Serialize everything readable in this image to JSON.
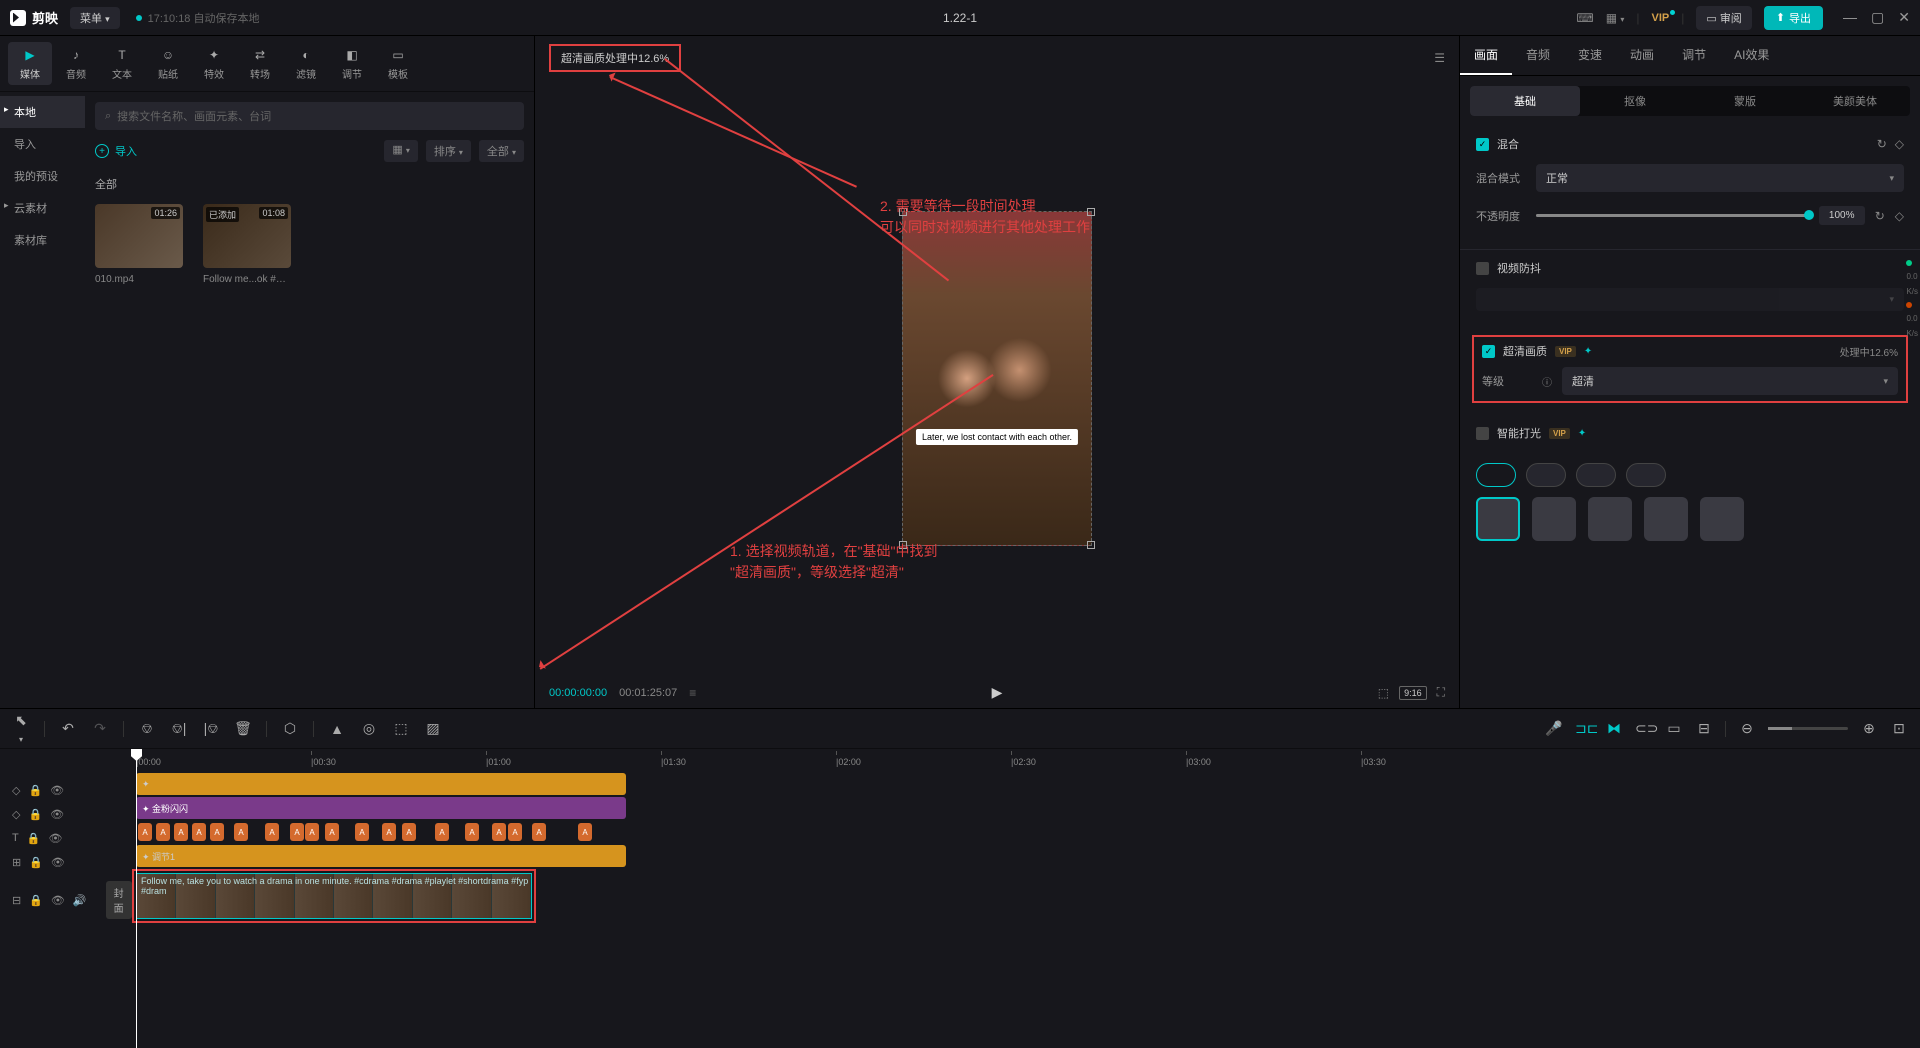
{
  "titlebar": {
    "app_name": "剪映",
    "menu": "菜单",
    "autosave": "17:10:18 自动保存本地",
    "project": "1.22-1",
    "vip": "VIP",
    "review": "审阅",
    "export": "导出"
  },
  "tool_tabs": [
    {
      "label": "媒体",
      "icon": "▶"
    },
    {
      "label": "音频",
      "icon": "♪"
    },
    {
      "label": "文本",
      "icon": "T"
    },
    {
      "label": "贴纸",
      "icon": "☺"
    },
    {
      "label": "特效",
      "icon": "✦"
    },
    {
      "label": "转场",
      "icon": "⇄"
    },
    {
      "label": "滤镜",
      "icon": "◐"
    },
    {
      "label": "调节",
      "icon": "◧"
    },
    {
      "label": "模板",
      "icon": "▭"
    }
  ],
  "sidebar": {
    "items": [
      "本地",
      "导入",
      "我的预设",
      "云素材",
      "素材库"
    ]
  },
  "media": {
    "search_placeholder": "搜索文件名称、画面元素、台词",
    "import": "导入",
    "sort": "排序",
    "filter": "全部",
    "all": "全部",
    "items": [
      {
        "name": "010.mp4",
        "duration": "01:26",
        "badge": ""
      },
      {
        "name": "Follow me...ok #3.mp4",
        "duration": "01:08",
        "badge": "已添加"
      }
    ]
  },
  "preview": {
    "processing": "超清画质处理中12.6%",
    "subtitle": "Later, we lost contact with each other.",
    "time_current": "00:00:00:00",
    "time_duration": "00:01:25:07",
    "ratio": "9:16"
  },
  "right": {
    "tabs": [
      "画面",
      "音频",
      "变速",
      "动画",
      "调节",
      "AI效果"
    ],
    "sub_tabs": [
      "基础",
      "抠像",
      "蒙版",
      "美颜美体"
    ],
    "blend": {
      "title": "混合",
      "mode_label": "混合模式",
      "mode_value": "正常"
    },
    "opacity": {
      "label": "不透明度",
      "value": "100%"
    },
    "stabilize": "视频防抖",
    "enhance": {
      "title": "超清画质",
      "status": "处理中12.6%",
      "level_label": "等级",
      "level_value": "超清"
    },
    "relight": "智能打光"
  },
  "annotations": {
    "step1_line1": "1. 选择视频轨道，在\"基础\"中找到",
    "step1_line2": "\"超清画质\"，等级选择\"超清\"",
    "step2_line1": "2. 需要等待一段时间处理",
    "step2_line2": "可以同时对视频进行其他处理工作"
  },
  "timeline": {
    "ticks": [
      "00:00",
      "00:30",
      "01:00",
      "01:30",
      "02:00",
      "02:30",
      "03:00",
      "03:30"
    ],
    "cover": "封面",
    "purple_label": "✦ 金粉闪闪",
    "adjust_label": "✦ 调节1",
    "video_label": "Follow me, take you to watch a drama in one minute. #cdrama #drama #playlet #shortdrama #fyp #dram",
    "text_marks_count": 19
  },
  "side_stats": [
    "0.0",
    "K/s",
    "0.0",
    "K/s"
  ]
}
